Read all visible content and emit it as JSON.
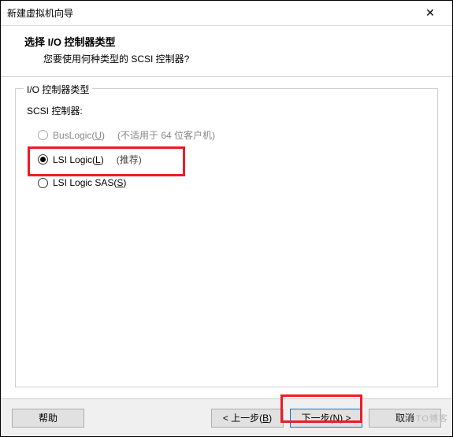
{
  "window": {
    "title": "新建虚拟机向导",
    "close_symbol": "✕"
  },
  "header": {
    "title": "选择 I/O 控制器类型",
    "description": "您要使用何种类型的 SCSI 控制器?"
  },
  "fieldset": {
    "legend": "I/O 控制器类型",
    "scsi_label": "SCSI 控制器:"
  },
  "options": {
    "buslogic": {
      "label_pre": "BusLogic(",
      "mnemonic": "U",
      "label_post": ")",
      "note": "(不适用于 64 位客户机)"
    },
    "lsilogic": {
      "label_pre": "LSI Logic(",
      "mnemonic": "L",
      "label_post": ")",
      "note": "(推荐)"
    },
    "lsisas": {
      "label_pre": "LSI Logic SAS(",
      "mnemonic": "S",
      "label_post": ")",
      "note": ""
    }
  },
  "buttons": {
    "help": "帮助",
    "back_pre": "< 上一步(",
    "back_mn": "B",
    "back_post": ")",
    "next_pre": "下一步(",
    "next_mn": "N",
    "next_post": ") >",
    "cancel": "取消"
  },
  "watermark": "51CTO博客"
}
